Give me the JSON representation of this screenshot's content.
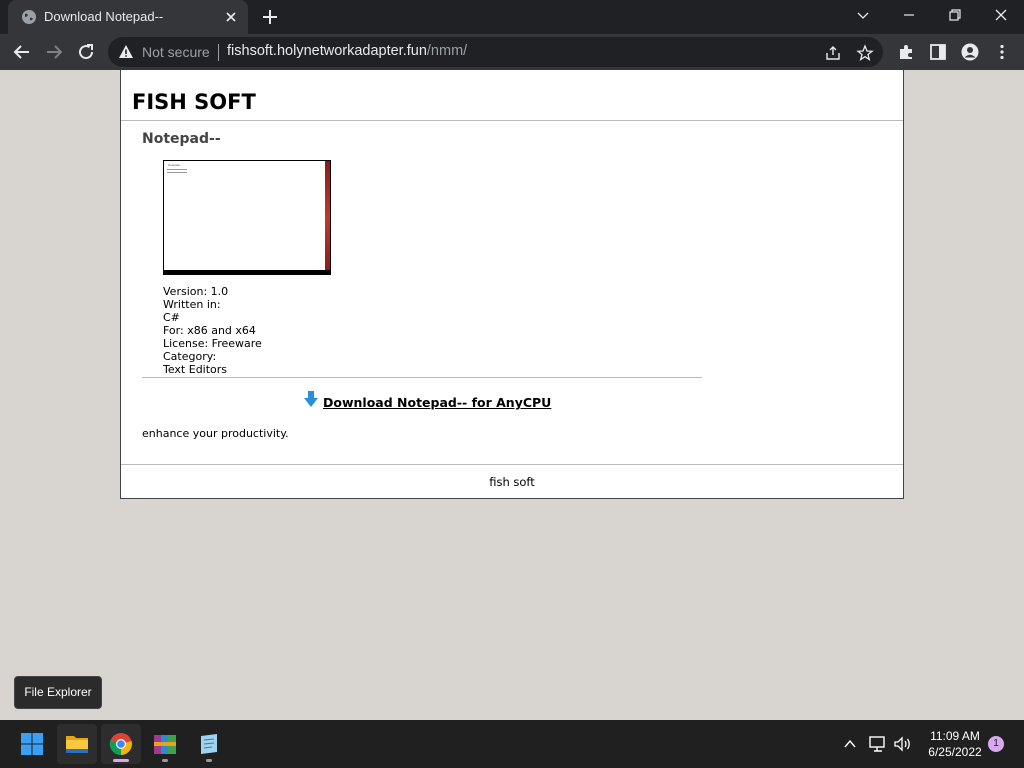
{
  "browser": {
    "tab_title": "Download Notepad--",
    "security_label": "Not secure",
    "url_host": "fishsoft.holynetworkadapter.fun",
    "url_path": "/nmm/"
  },
  "page": {
    "site_title": "FISH SOFT",
    "product_title": "Notepad--",
    "screenshot_window_title": "Notepad--",
    "info": {
      "version": "Version: 1.0",
      "written_in_label": "Written in:",
      "written_in_value": "C#",
      "platform": "For: x86 and x64",
      "license": "License: Freeware",
      "category_label": "Category:",
      "category_value": "Text Editors"
    },
    "download_link": "Download Notepad-- for AnyCPU",
    "description": "enhance your productivity.",
    "footer": "fish soft"
  },
  "tooltip": "File Explorer",
  "taskbar": {
    "time": "11:09 AM",
    "date": "6/25/2022",
    "notification_count": "1",
    "apps": [
      "start-button",
      "file-explorer",
      "chrome",
      "winrar",
      "notepad"
    ]
  },
  "colors": {
    "desktop_bg": "#d8d5d0",
    "chrome_dark": "#202124",
    "chrome_toolbar": "#35363a",
    "download_arrow": "#2a8fd8",
    "taskbar": "#202020"
  }
}
